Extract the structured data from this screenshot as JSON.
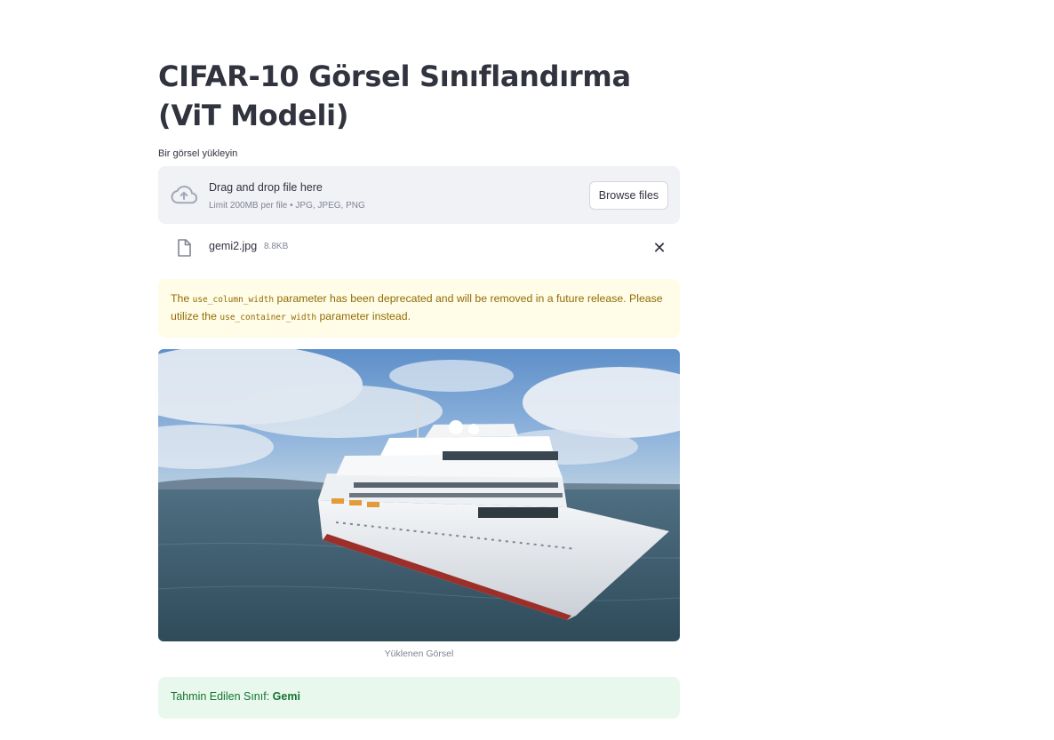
{
  "page": {
    "title": "CIFAR-10 Görsel Sınıflandırma (ViT Modeli)"
  },
  "uploader": {
    "label": "Bir görsel yükleyin",
    "drop_title": "Drag and drop file here",
    "drop_subtitle": "Limit 200MB per file • JPG, JPEG, PNG",
    "browse_label": "Browse files",
    "icon": "cloud-upload-icon"
  },
  "uploaded_file": {
    "name": "gemi2.jpg",
    "size": "8.8KB",
    "icon": "file-icon",
    "close_glyph": "✕"
  },
  "warning": {
    "text_before": "The ",
    "code_1": "use_column_width",
    "text_middle": " parameter has been deprecated and will be removed in a future release. Please utilize the ",
    "code_2": "use_container_width",
    "text_after": " parameter instead."
  },
  "image": {
    "caption": "Yüklenen Görsel"
  },
  "result": {
    "label": "Tahmin Edilen Sınıf: ",
    "value": "Gemi"
  },
  "colors": {
    "text": "#31333f",
    "muted": "#808495",
    "dropzone_bg": "#f0f2f6",
    "warning_bg": "#fffce7",
    "warning_text": "#926c05",
    "success_bg": "#e8f8ec",
    "success_text": "#177233"
  }
}
